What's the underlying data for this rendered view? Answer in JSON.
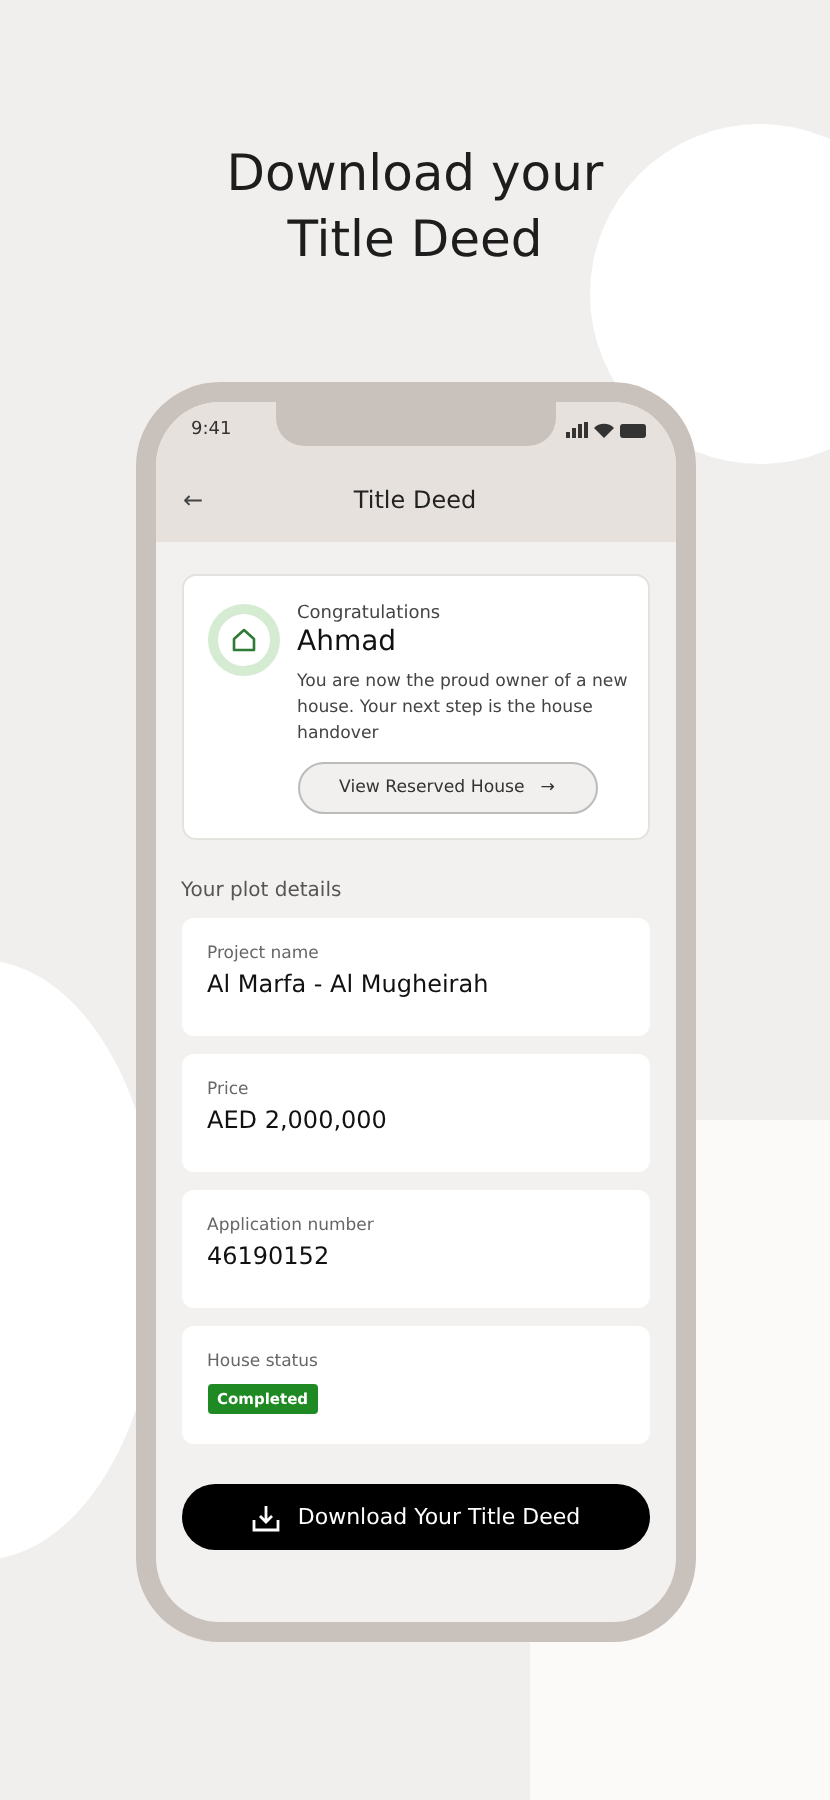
{
  "headline": "Download your Title Deed",
  "status_bar": {
    "time": "9:41"
  },
  "header": {
    "back": "←",
    "title": "Title Deed"
  },
  "congrats": {
    "greeting": "Congratulations",
    "name": "Ahmad",
    "message": "You are now the proud owner of a new house. Your next step is the house handover",
    "button": "View Reserved House",
    "button_arrow": "→"
  },
  "section_title": "Your plot details",
  "details": [
    {
      "kind": "text",
      "label": "Project name",
      "value": "Al Marfa - Al Mugheirah"
    },
    {
      "kind": "text",
      "label": "Price",
      "value": "AED 2,000,000"
    },
    {
      "kind": "text",
      "label": "Application number",
      "value": "46190152"
    },
    {
      "kind": "badge",
      "label": "House status",
      "value": "Completed",
      "color": "#1f8a24"
    }
  ],
  "download_button": "Download Your Title Deed"
}
